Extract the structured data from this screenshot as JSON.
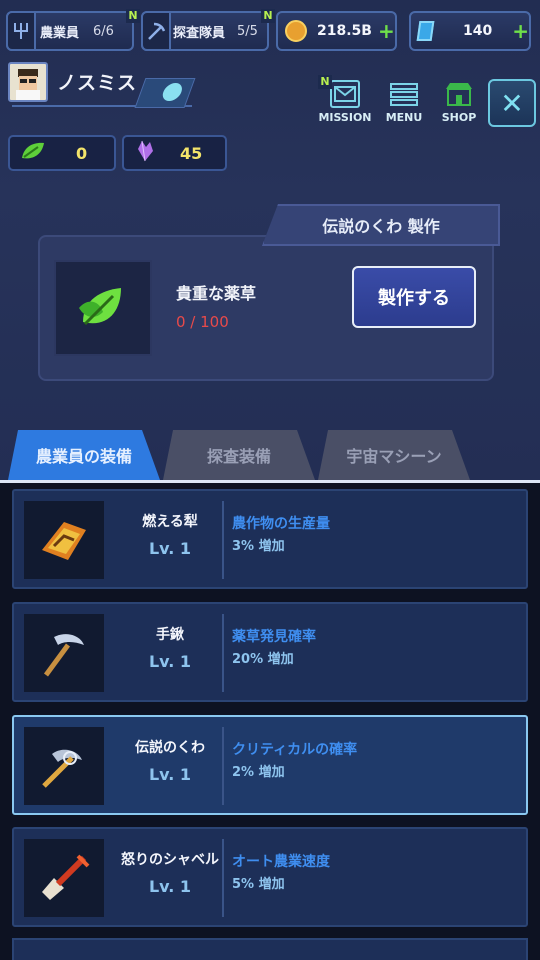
{
  "header": {
    "farmers": {
      "label": "農業員",
      "value": "6/6",
      "badge": "N"
    },
    "explorers": {
      "label": "探査隊員",
      "value": "5/5",
      "badge": "N"
    },
    "coins": {
      "value": "218.5B",
      "plus": "+"
    },
    "gems": {
      "value": "140",
      "plus": "+"
    }
  },
  "profile": {
    "name": "ノスミス"
  },
  "resources": {
    "herb": "0",
    "crystal": "45"
  },
  "menu": {
    "mission": {
      "label": "MISSION",
      "badge": "N"
    },
    "menu": {
      "label": "MENU"
    },
    "shop": {
      "label": "SHOP"
    },
    "close_glyph": "✕"
  },
  "craft": {
    "title": "伝説のくわ 製作",
    "item_name": "貴重な薬草",
    "item_count": "0 / 100",
    "button": "製作する"
  },
  "tabs": [
    {
      "label": "農業員の装備",
      "active": true
    },
    {
      "label": "探査装備",
      "active": false
    },
    {
      "label": "宇宙マシーン",
      "active": false
    }
  ],
  "equipment": [
    {
      "name": "燃える犁",
      "level": "Lv. 1",
      "effect": "農作物の生産量",
      "effect_value": "3% 増加",
      "selected": false
    },
    {
      "name": "手鍬",
      "level": "Lv. 1",
      "effect": "薬草発見確率",
      "effect_value": "20% 増加",
      "selected": false
    },
    {
      "name": "伝説のくわ",
      "level": "Lv. 1",
      "effect": "クリティカルの確率",
      "effect_value": "2% 増加",
      "selected": true
    },
    {
      "name": "怒りのシャベル",
      "level": "Lv. 1",
      "effect": "オート農業速度",
      "effect_value": "5% 増加",
      "selected": false
    }
  ],
  "colors": {
    "accent": "#2e7ae0",
    "gold": "#f3e46a",
    "red": "#e84a4a",
    "plus": "#6fe04a"
  }
}
